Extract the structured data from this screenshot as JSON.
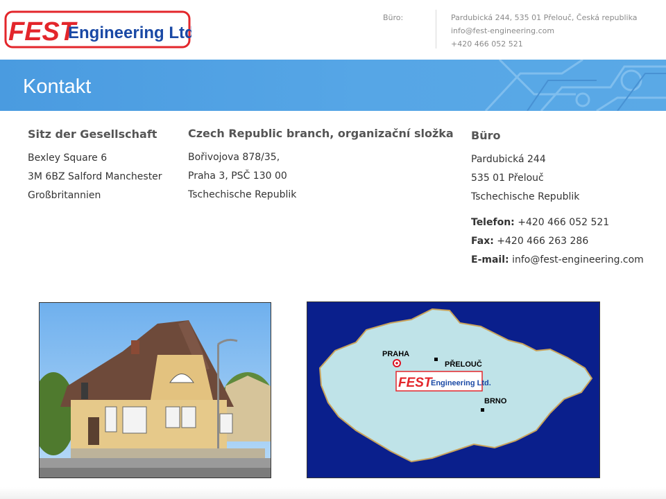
{
  "header": {
    "logo_text": "FEST Engineering Ltd.",
    "office_label": "Büro:",
    "office_address": "Pardubická 244, 535 01 Přelouč, Česká republika",
    "office_email": "info@fest-engineering.com",
    "office_phone": "+420 466 052 521"
  },
  "banner": {
    "title": "Kontakt"
  },
  "columns": {
    "hq": {
      "heading": "Sitz der Gesellschaft",
      "lines": [
        "Bexley Square 6",
        "3M 6BZ Salford Manchester",
        "Großbritannien"
      ]
    },
    "branch": {
      "heading": "Czech Republic branch, organizační složka",
      "lines": [
        "Bořivojova 878/35,",
        "Praha 3, PSČ 130 00",
        "Tschechische Republik"
      ]
    },
    "office": {
      "heading": "Büro",
      "lines": [
        "Pardubická 244",
        "535 01 Přelouč",
        "Tschechische Republik"
      ],
      "phone_label": "Telefon:",
      "phone": "+420 466 052 521",
      "fax_label": "Fax:",
      "fax": "+420 466 263 286",
      "email_label": "E-mail:",
      "email": "info@fest-engineering.com"
    }
  },
  "map": {
    "labels": {
      "praha": "PRAHA",
      "prelouc": "PŘELOUČ",
      "brno": "BRNO"
    },
    "logo_text": "FEST Engineering Ltd."
  },
  "colors": {
    "brand_red": "#e3262b",
    "brand_blue": "#1a49a5",
    "banner_blue": "#4fa1e4",
    "map_sea": "#0a1f8c",
    "map_land": "#bfe3e8"
  }
}
